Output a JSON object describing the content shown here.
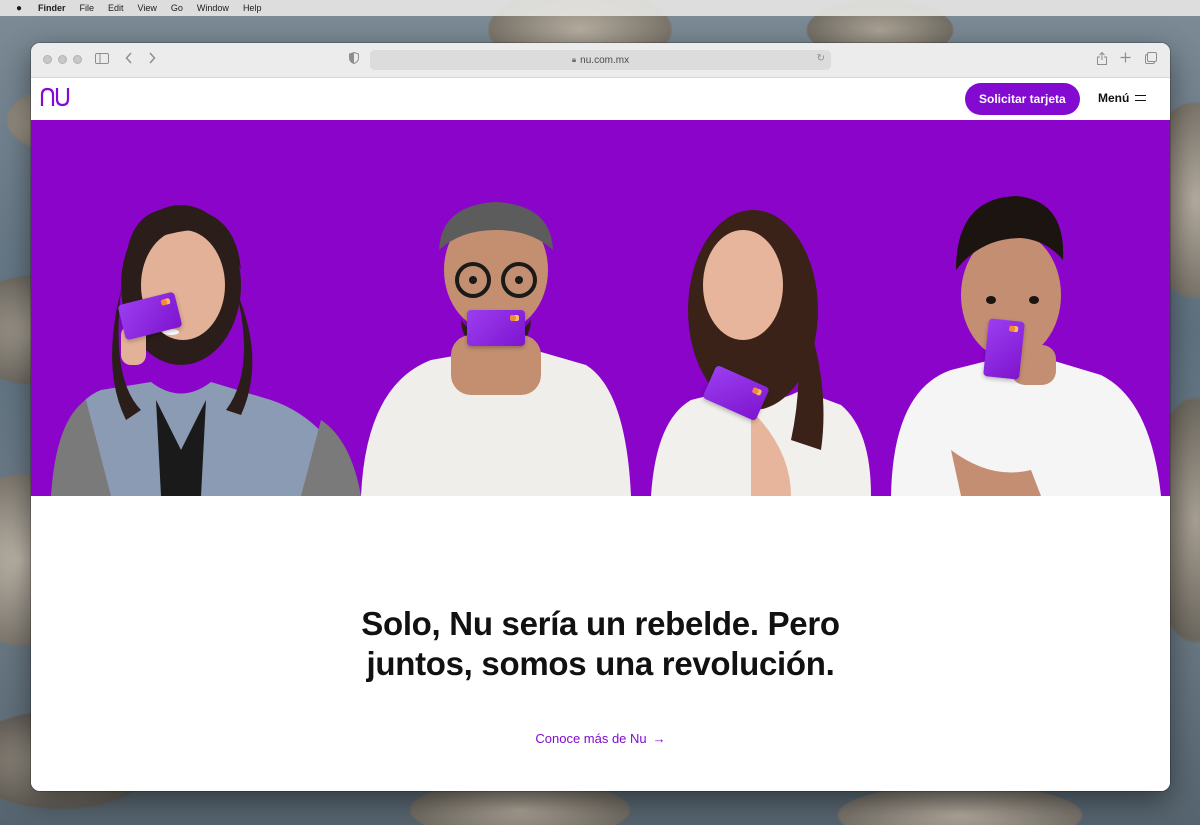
{
  "menubar": {
    "app_name": "Finder",
    "items": [
      "File",
      "Edit",
      "View",
      "Go",
      "Window",
      "Help"
    ]
  },
  "browser": {
    "url": "nu.com.mx"
  },
  "header": {
    "cta_label": "Solicitar tarjeta",
    "menu_label": "Menú"
  },
  "main": {
    "headline_line1": "Solo, Nu sería un rebelde. Pero",
    "headline_line2": "juntos, somos una revolución.",
    "link_label": "Conoce más de Nu",
    "link_arrow": "→"
  },
  "colors": {
    "brand_purple": "#820ad1",
    "hero_purple": "#8a05c9"
  }
}
